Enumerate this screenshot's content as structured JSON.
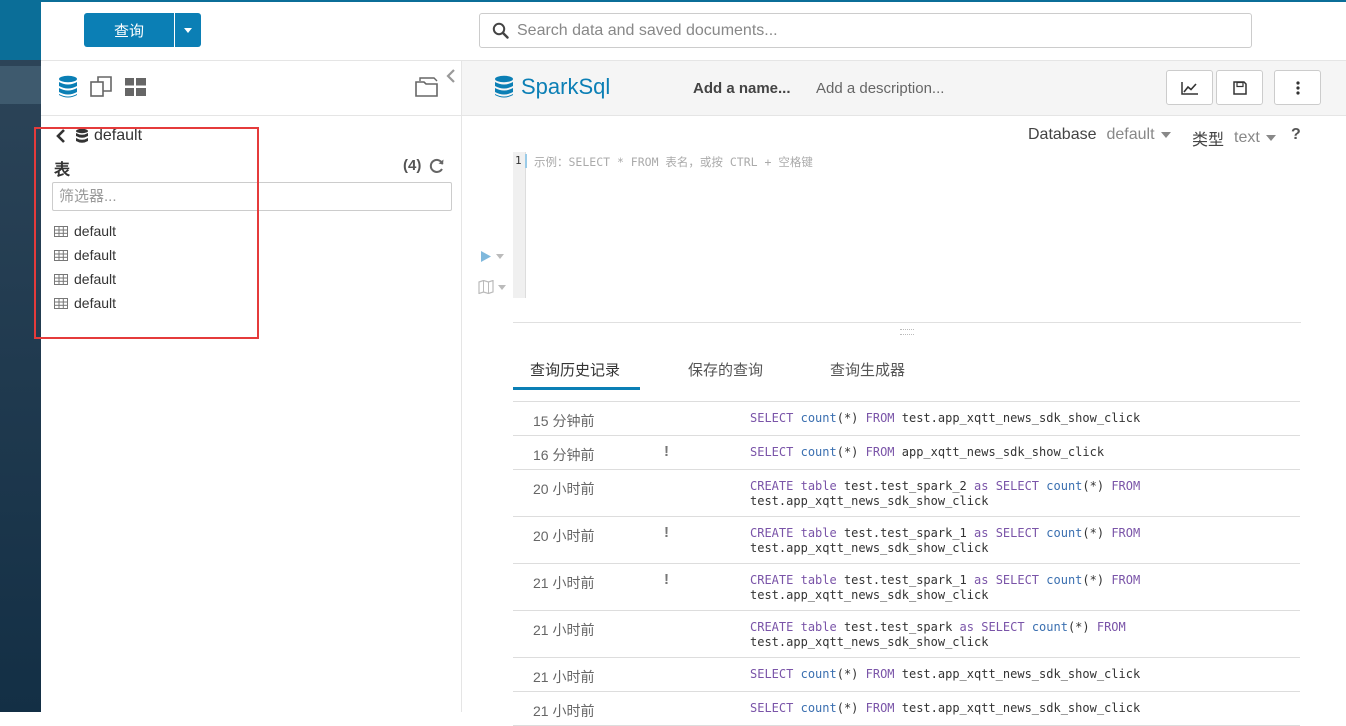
{
  "topbar": {
    "query_button": "查询",
    "search_placeholder": "Search data and saved documents..."
  },
  "left_panel": {
    "database": "default",
    "tables_heading": "表",
    "tables_count": "(4)",
    "filter_placeholder": "筛选器...",
    "tables": [
      "default",
      "default",
      "default",
      "default"
    ]
  },
  "editor": {
    "title": "SparkSql",
    "add_name": "Add a name...",
    "add_description": "Add a description...",
    "database_label": "Database",
    "database_value": "default",
    "type_label": "类型",
    "type_value": "text",
    "help": "?",
    "line_number": "1",
    "placeholder": "示例：SELECT * FROM 表名，或按 CTRL + 空格键"
  },
  "tabs": [
    "查询历史记录",
    "保存的查询",
    "查询生成器"
  ],
  "history": [
    {
      "time": "15 分钟前",
      "warn": "",
      "lines": [
        [
          "SELECT|kw",
          " ",
          "count|fn",
          "(*) ",
          "FROM|kw",
          " test.app_xqtt_news_sdk_show_click"
        ]
      ]
    },
    {
      "time": "16 分钟前",
      "warn": "!",
      "lines": [
        [
          "SELECT|kw",
          " ",
          "count|fn",
          "(*) ",
          "FROM|kw",
          " app_xqtt_news_sdk_show_click"
        ]
      ]
    },
    {
      "time": "20 小时前",
      "warn": "",
      "lines": [
        [
          "CREATE|kw",
          " ",
          "table|kw",
          " test.test_spark_2 ",
          "as|kw",
          " ",
          "SELECT|kw",
          " ",
          "count|fn",
          "(*) ",
          "FROM|kw"
        ],
        [
          "test.app_xqtt_news_sdk_show_click"
        ]
      ]
    },
    {
      "time": "20 小时前",
      "warn": "!",
      "lines": [
        [
          "CREATE|kw",
          " ",
          "table|kw",
          " test.test_spark_1 ",
          "as|kw",
          " ",
          "SELECT|kw",
          " ",
          "count|fn",
          "(*) ",
          "FROM|kw"
        ],
        [
          "test.app_xqtt_news_sdk_show_click"
        ]
      ]
    },
    {
      "time": "21 小时前",
      "warn": "!",
      "lines": [
        [
          "CREATE|kw",
          " ",
          "table|kw",
          " test.test_spark_1 ",
          "as|kw",
          " ",
          "SELECT|kw",
          " ",
          "count|fn",
          "(*) ",
          "FROM|kw"
        ],
        [
          "test.app_xqtt_news_sdk_show_click"
        ]
      ]
    },
    {
      "time": "21 小时前",
      "warn": "",
      "lines": [
        [
          "CREATE|kw",
          " ",
          "table|kw",
          " test.test_spark ",
          "as|kw",
          " ",
          "SELECT|kw",
          " ",
          "count|fn",
          "(*) ",
          "FROM|kw"
        ],
        [
          "test.app_xqtt_news_sdk_show_click"
        ]
      ]
    },
    {
      "time": "21 小时前",
      "warn": "",
      "lines": [
        [
          "SELECT|kw",
          " ",
          "count|fn",
          "(*) ",
          "FROM|kw",
          " test.app_xqtt_news_sdk_show_click"
        ]
      ]
    },
    {
      "time": "21 小时前",
      "warn": "",
      "lines": [
        [
          "SELECT|kw",
          " ",
          "count|fn",
          "(*) ",
          "FROM|kw",
          " test.app_xqtt_news_sdk_show_click"
        ]
      ]
    }
  ]
}
